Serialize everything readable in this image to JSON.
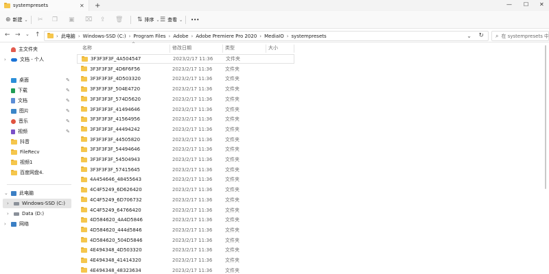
{
  "window": {
    "tab_title": "systempresets",
    "tab_close": "✕",
    "new_tab": "+",
    "minimize": "—",
    "maximize": "☐",
    "close": "✕"
  },
  "toolbar": {
    "new_label": "新建",
    "sort_label": "排序",
    "view_label": "查看",
    "more_label": "•••"
  },
  "nav": {
    "back": "←",
    "forward": "→",
    "recent": "⌄",
    "up": "↑"
  },
  "address": {
    "crumbs": [
      "此电脑",
      "Windows-SSD (C:)",
      "Program Files",
      "Adobe",
      "Adobe Premiere Pro 2020",
      "MediaIO",
      "systempresets"
    ]
  },
  "search": {
    "placeholder": "在 systempresets 中搜索"
  },
  "sidebar": {
    "items": [
      {
        "label": "主文件夹"
      },
      {
        "label": "文档 - 个人"
      },
      {
        "label": "桌面"
      },
      {
        "label": "下载"
      },
      {
        "label": "文档"
      },
      {
        "label": "图片"
      },
      {
        "label": "音乐"
      },
      {
        "label": "视频"
      },
      {
        "label": "抖音"
      },
      {
        "label": "FileRecv"
      },
      {
        "label": "视频1"
      },
      {
        "label": "百度网盘4."
      },
      {
        "label": "此电脑"
      },
      {
        "label": "Windows-SSD (C:)"
      },
      {
        "label": "Data (D:)"
      },
      {
        "label": "网络"
      }
    ]
  },
  "columns": {
    "name": "名称",
    "modified": "修改日期",
    "type": "类型",
    "size": "大小"
  },
  "files": [
    {
      "name": "3F3F3F3F_4A504547",
      "date": "2023/2/17 11:36",
      "type": "文件夹"
    },
    {
      "name": "3F3F3F3F_4D6F6F56",
      "date": "2023/2/17 11:36",
      "type": "文件夹"
    },
    {
      "name": "3F3F3F3F_4D503320",
      "date": "2023/2/17 11:36",
      "type": "文件夹"
    },
    {
      "name": "3F3F3F3F_504E4720",
      "date": "2023/2/17 11:36",
      "type": "文件夹"
    },
    {
      "name": "3F3F3F3F_574D5620",
      "date": "2023/2/17 11:36",
      "type": "文件夹"
    },
    {
      "name": "3F3F3F3F_41494646",
      "date": "2023/2/17 11:36",
      "type": "文件夹"
    },
    {
      "name": "3F3F3F3F_41564956",
      "date": "2023/2/17 11:36",
      "type": "文件夹"
    },
    {
      "name": "3F3F3F3F_44494242",
      "date": "2023/2/17 11:36",
      "type": "文件夹"
    },
    {
      "name": "3F3F3F3F_44505820",
      "date": "2023/2/17 11:36",
      "type": "文件夹"
    },
    {
      "name": "3F3F3F3F_54494646",
      "date": "2023/2/17 11:36",
      "type": "文件夹"
    },
    {
      "name": "3F3F3F3F_54504943",
      "date": "2023/2/17 11:36",
      "type": "文件夹"
    },
    {
      "name": "3F3F3F3F_57415645",
      "date": "2023/2/17 11:36",
      "type": "文件夹"
    },
    {
      "name": "4A454646_48455643",
      "date": "2023/2/17 11:36",
      "type": "文件夹"
    },
    {
      "name": "4C4F5249_6D626420",
      "date": "2023/2/17 11:36",
      "type": "文件夹"
    },
    {
      "name": "4C4F5249_6D706732",
      "date": "2023/2/17 11:36",
      "type": "文件夹"
    },
    {
      "name": "4C4F5249_64766420",
      "date": "2023/2/17 11:36",
      "type": "文件夹"
    },
    {
      "name": "4D584620_4A4D5846",
      "date": "2023/2/17 11:36",
      "type": "文件夹"
    },
    {
      "name": "4D584620_444d5846",
      "date": "2023/2/17 11:36",
      "type": "文件夹"
    },
    {
      "name": "4D584620_504D5846",
      "date": "2023/2/17 11:36",
      "type": "文件夹"
    },
    {
      "name": "4E494348_4D503320",
      "date": "2023/2/17 11:36",
      "type": "文件夹"
    },
    {
      "name": "4E494348_41414320",
      "date": "2023/2/17 11:36",
      "type": "文件夹"
    },
    {
      "name": "4E494348_48323634",
      "date": "2023/2/17 11:36",
      "type": "文件夹"
    }
  ],
  "colors": {
    "folder": "#f5c64c",
    "accent": "#0067c0"
  }
}
